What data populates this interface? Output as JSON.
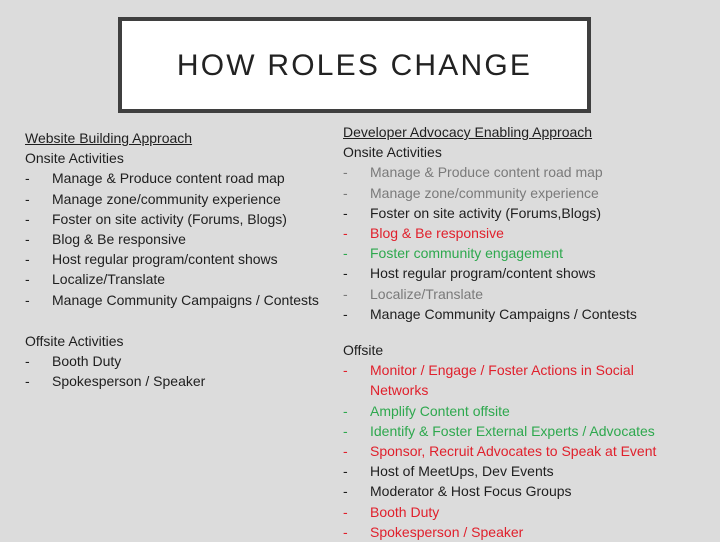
{
  "title": "HOW ROLES CHANGE",
  "colors": {
    "background": "#dcdcdc",
    "gray": "#7a7a7a",
    "black": "#1e1e1e",
    "red": "#e0202c",
    "green": "#2ea84e"
  },
  "left": {
    "heading": "Website Building Approach",
    "onsite": {
      "label": "Onsite Activities",
      "items": [
        {
          "text": "Manage & Produce content road map",
          "color": "black"
        },
        {
          "text": "Manage zone/community experience",
          "color": "black"
        },
        {
          "text": "Foster on site activity (Forums, Blogs)",
          "color": "black"
        },
        {
          "text": "Blog & Be responsive",
          "color": "black"
        },
        {
          "text": "Host regular program/content shows",
          "color": "black"
        },
        {
          "text": "Localize/Translate",
          "color": "black"
        },
        {
          "text": "Manage Community Campaigns / Contests",
          "color": "black"
        }
      ]
    },
    "offsite": {
      "label": "Offsite Activities",
      "items": [
        {
          "text": "Booth Duty",
          "color": "black"
        },
        {
          "text": "Spokesperson / Speaker",
          "color": "black"
        }
      ]
    }
  },
  "right": {
    "heading": "Developer Advocacy Enabling Approach",
    "onsite": {
      "label": "Onsite Activities",
      "items": [
        {
          "text": "Manage & Produce content road map",
          "color": "gray"
        },
        {
          "text": "Manage zone/community experience",
          "color": "gray"
        },
        {
          "text": "Foster on site activity (Forums,Blogs)",
          "color": "black"
        },
        {
          "text": "Blog & Be responsive",
          "color": "red"
        },
        {
          "text": "Foster community engagement",
          "color": "green"
        },
        {
          "text": "Host regular program/content shows",
          "color": "black"
        },
        {
          "text": "Localize/Translate",
          "color": "gray"
        },
        {
          "text": "Manage Community Campaigns / Contests",
          "color": "black"
        }
      ]
    },
    "offsite": {
      "label": "Offsite",
      "items": [
        {
          "text": "Monitor / Engage / Foster Actions in Social Networks",
          "color": "red"
        },
        {
          "text": "Amplify Content offsite",
          "color": "green"
        },
        {
          "text": "Identify & Foster External Experts / Advocates",
          "color": "green"
        },
        {
          "text": "Sponsor, Recruit Advocates to Speak at Event",
          "color": "red"
        },
        {
          "text": "Host of MeetUps, Dev  Events",
          "color": "black"
        },
        {
          "text": "Moderator & Host Focus Groups",
          "color": "black"
        },
        {
          "text": "Booth Duty",
          "color": "red"
        },
        {
          "text": "Spokesperson / Speaker",
          "color": "red"
        }
      ]
    }
  },
  "bullet": "-"
}
